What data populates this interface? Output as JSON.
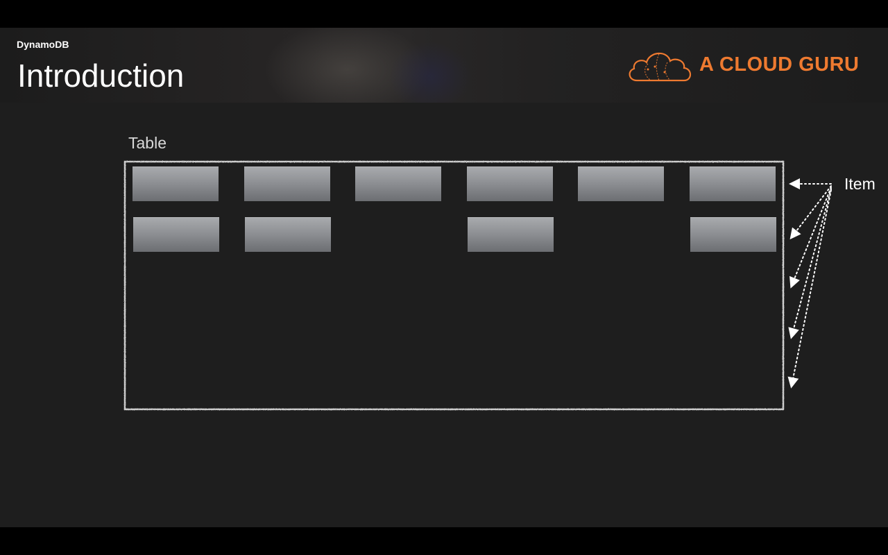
{
  "header": {
    "subtitle": "DynamoDB",
    "title": "Introduction",
    "logo_text": "A CLOUD GURU",
    "logo_icon": "cloud-icon"
  },
  "diagram": {
    "table_label": "Table",
    "item_label": "Item",
    "rows": [
      {
        "attributes": [
          true,
          true,
          true,
          true,
          true,
          true
        ]
      },
      {
        "attributes": [
          true,
          true,
          false,
          true,
          false,
          true
        ]
      },
      {
        "attributes": [
          false,
          false,
          false,
          false,
          false,
          false
        ]
      },
      {
        "attributes": [
          false,
          false,
          false,
          false,
          false,
          false
        ]
      },
      {
        "attributes": [
          false,
          false,
          false,
          false,
          false,
          false
        ]
      }
    ]
  },
  "colors": {
    "accent": "#ee7a30",
    "background": "#1e1e1e",
    "chalk": "#d0d0d0"
  }
}
